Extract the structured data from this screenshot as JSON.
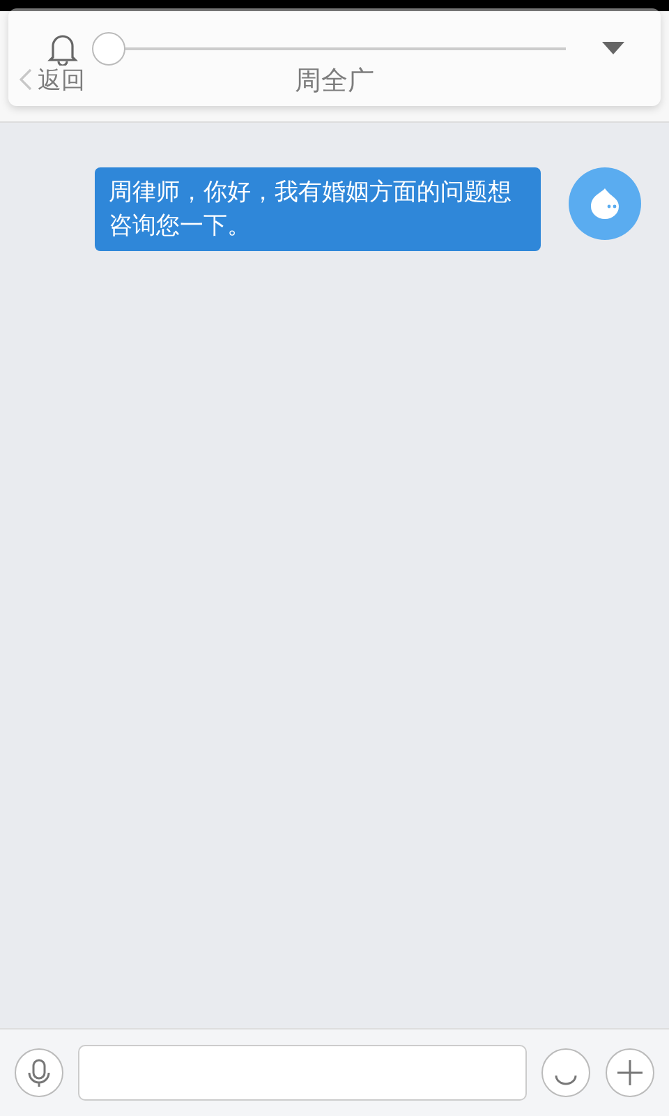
{
  "nav_bar": {
    "back": "返回",
    "title": "周全广"
  },
  "volume_popup": {
    "level": 0
  },
  "messages": [
    {
      "text": "周律师，你好，我有婚姻方面的问题想咨询您一下。",
      "outgoing": true
    }
  ]
}
